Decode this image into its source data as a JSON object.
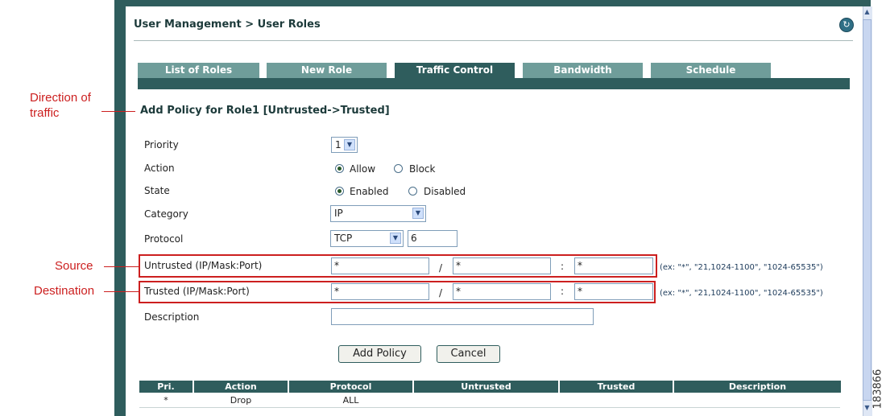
{
  "breadcrumb": "User Management > User Roles",
  "tabs": [
    {
      "label": "List of Roles"
    },
    {
      "label": "New Role"
    },
    {
      "label": "Traffic Control"
    },
    {
      "label": "Bandwidth"
    },
    {
      "label": "Schedule"
    }
  ],
  "form": {
    "title": "Add Policy for Role1 [Untrusted->Trusted]",
    "priority": {
      "label": "Priority",
      "value": "1"
    },
    "action": {
      "label": "Action",
      "options": [
        "Allow",
        "Block"
      ],
      "selected": "Allow"
    },
    "state": {
      "label": "State",
      "options": [
        "Enabled",
        "Disabled"
      ],
      "selected": "Enabled"
    },
    "category": {
      "label": "Category",
      "value": "IP"
    },
    "protocol": {
      "label": "Protocol",
      "value": "TCP",
      "number": "6"
    },
    "untrusted": {
      "label": "Untrusted (IP/Mask:Port)",
      "ip": "*",
      "mask": "*",
      "port": "*"
    },
    "trusted": {
      "label": "Trusted (IP/Mask:Port)",
      "ip": "*",
      "mask": "*",
      "port": "*"
    },
    "separators": {
      "slash": "/",
      "colon": ":"
    },
    "port_hint": "(ex: \"*\", \"21,1024-1100\", \"1024-65535\")",
    "description": {
      "label": "Description",
      "value": ""
    },
    "add_button": "Add Policy",
    "cancel_button": "Cancel"
  },
  "policy_table": {
    "columns": [
      "Pri.",
      "Action",
      "Protocol",
      "Untrusted",
      "Trusted",
      "Description"
    ],
    "rows": [
      {
        "pri": "*",
        "action": "Drop",
        "protocol": "ALL",
        "untrusted": "",
        "trusted": "",
        "description": ""
      }
    ]
  },
  "annotations": {
    "direction": "Direction of traffic",
    "source": "Source",
    "destination": "Destination"
  },
  "figure_number": "183866",
  "colors": {
    "frame": "#2f5d5d",
    "tab": "#6f9d9a",
    "callout": "#cc1f1f"
  }
}
